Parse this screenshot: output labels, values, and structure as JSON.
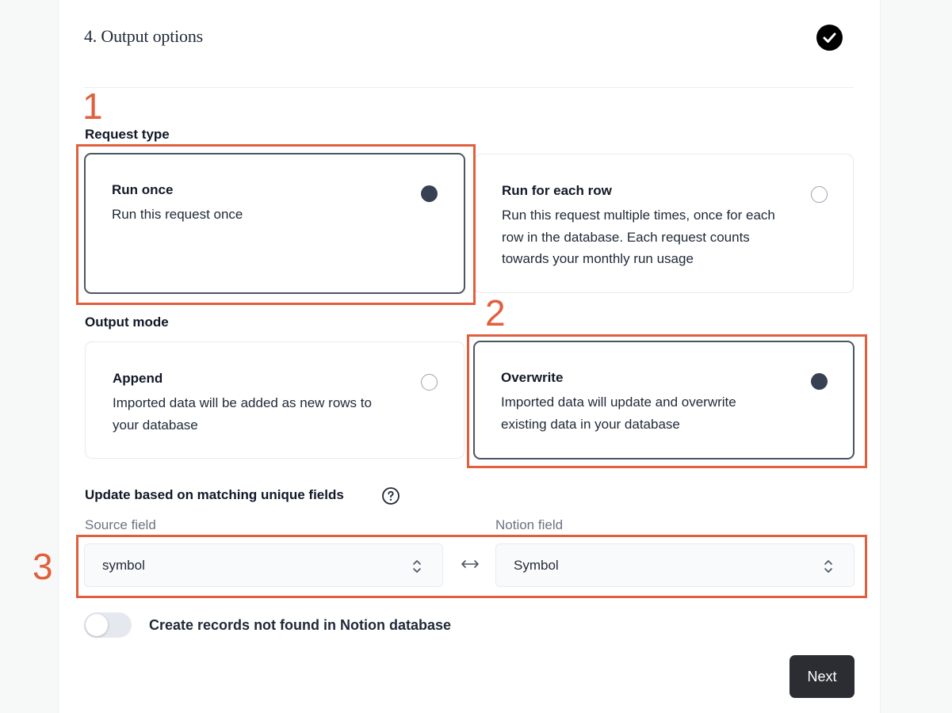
{
  "step": {
    "title": "4. Output options"
  },
  "request_type": {
    "label": "Request type",
    "options": [
      {
        "title": "Run once",
        "description": "Run this request once",
        "selected": true
      },
      {
        "title": "Run for each row",
        "description_lines": [
          "Run this request multiple times, once for each",
          "row in the database. Each request counts",
          "towards your monthly run usage"
        ],
        "selected": false
      }
    ]
  },
  "output_mode": {
    "label": "Output mode",
    "options": [
      {
        "title": "Append",
        "description_lines": [
          "Imported data will be added as new rows to",
          "your database"
        ],
        "selected": false
      },
      {
        "title": "Overwrite",
        "description_lines": [
          "Imported data will update and overwrite",
          "existing data in your database"
        ],
        "selected": true
      }
    ]
  },
  "matching": {
    "label": "Update based on matching unique fields",
    "help_icon": "question-circle-icon",
    "source_label": "Source field",
    "source_value": "symbol",
    "notion_label": "Notion field",
    "notion_value": "Symbol",
    "swap_icon": "left-right-arrow-icon"
  },
  "create_records": {
    "label": "Create records not found in Notion database",
    "enabled": false
  },
  "next_button": {
    "label": "Next"
  },
  "annotations": [
    "1",
    "2",
    "3"
  ],
  "colors": {
    "annotation": "#e15f3c",
    "selected_border": "#4b5563",
    "button_bg": "#2b2d33"
  }
}
